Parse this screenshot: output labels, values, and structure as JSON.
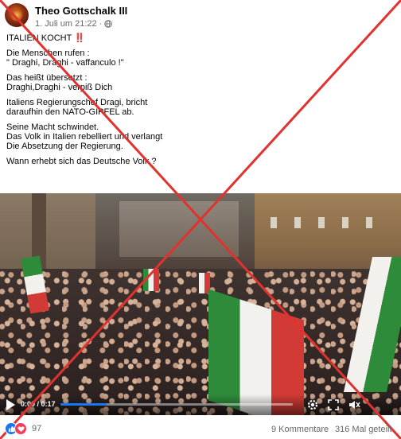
{
  "post": {
    "author": "Theo Gottschalk III",
    "timestamp": "1. Juli um 21:22",
    "privacy_icon": "globe-icon",
    "paragraphs": [
      "ITALIEN KOCHT ",
      "Die Menschen rufen :\n\" Draghi, Draghi - vaffanculo !\"",
      "Das heißt  übersetzt :\nDraghi,Draghi - verpiß Dich",
      "Italiens Regierungschef Dragi, bricht\ndaraufhin den NATO-GIPFEL ab.",
      "Seine Macht schwindet.\nDas Volk in Italien rebelliert und verlangt\nDie Absetzung der Regierung.",
      "Wann erhebt sich das Deutsche Volk ?"
    ],
    "emphasis_mark": "‼️"
  },
  "video": {
    "time_display": "0:00 / 0:17",
    "progress": 0.2,
    "overlay": "red-x-mark",
    "overlay_color": "#e0332f"
  },
  "footer": {
    "reaction_icons": [
      "like-icon",
      "love-icon"
    ],
    "reaction_count": "97",
    "comments": "9 Kommentare",
    "shares": "316 Mal geteilt"
  },
  "colors": {
    "like": "#1877f2",
    "love": "#f33e58",
    "meta_text": "#65676b",
    "emphasis": "#e0245e"
  }
}
